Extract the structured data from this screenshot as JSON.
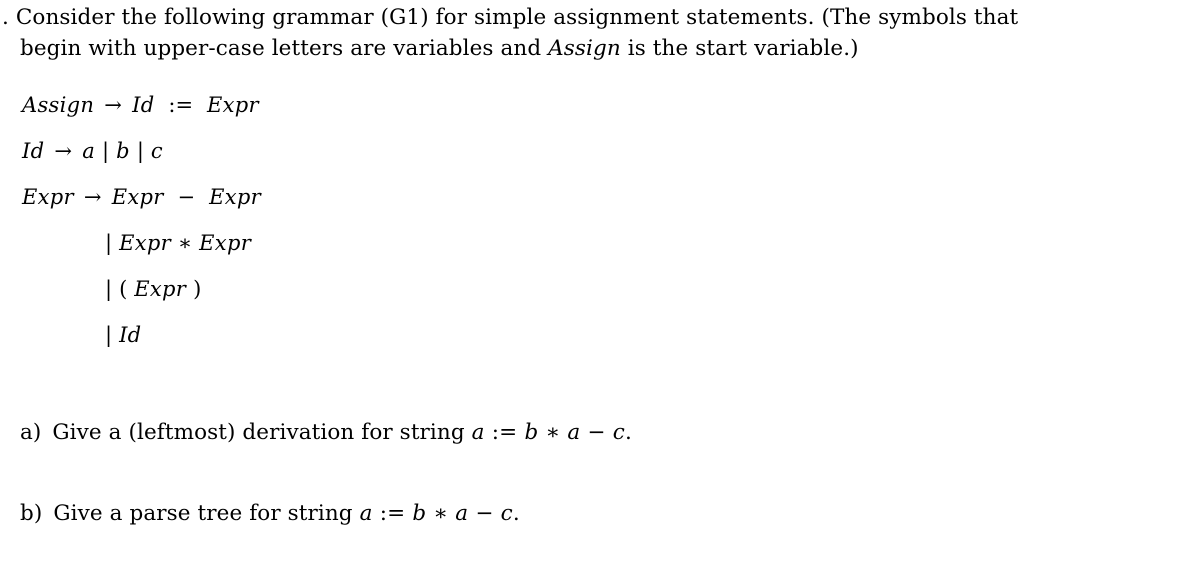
{
  "document": {
    "type": "exercise-sheet",
    "background_color": "#ffffff",
    "text_color": "#000000"
  },
  "intro": {
    "marker": ".",
    "line1": "Consider the following grammar (G1) for simple assignment statements.  (The symbols that",
    "line2_part1": "begin with upper-case letters are variables and ",
    "line2_italic": "Assign",
    "line2_part2": " is the start variable.)"
  },
  "grammar": {
    "productions": [
      {
        "lhs": "Assign",
        "arrow": "→",
        "rhs_1": "Id",
        "operator": ":=",
        "rhs_2": "Expr"
      },
      {
        "lhs": "Id",
        "arrow": "→",
        "alternatives": [
          "a",
          "b",
          "c"
        ],
        "separator": "|"
      },
      {
        "lhs": "Expr",
        "arrow": "→",
        "rhs_1": "Expr",
        "operator": "−",
        "rhs_2": "Expr"
      }
    ],
    "continuations": [
      {
        "bar": "|",
        "left": "Expr",
        "operator": "∗",
        "right": "Expr"
      },
      {
        "bar": "|",
        "open": "(",
        "middle": "Expr",
        "close": ")"
      },
      {
        "bar": "|",
        "single": "Id"
      }
    ]
  },
  "questions": [
    {
      "label": "a)",
      "text": "Give a (leftmost) derivation for string ",
      "expression": {
        "var1": "a",
        "assign": ":=",
        "var2": "b",
        "times": "∗",
        "var3": "a",
        "minus": "−",
        "var4": "c",
        "period": "."
      }
    },
    {
      "label": "b)",
      "text": "Give a parse tree for string ",
      "expression": {
        "var1": "a",
        "assign": ":=",
        "var2": "b",
        "times": "∗",
        "var3": "a",
        "minus": "−",
        "var4": "c",
        "period": "."
      }
    }
  ]
}
